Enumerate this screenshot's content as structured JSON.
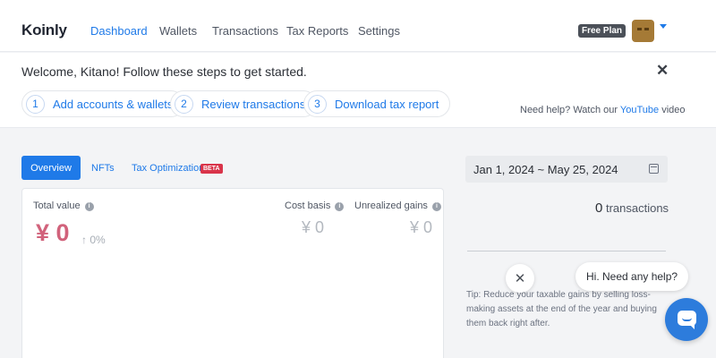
{
  "app": {
    "logo": "Koinly"
  },
  "nav": {
    "items": [
      {
        "label": "Dashboard",
        "active": true
      },
      {
        "label": "Wallets"
      },
      {
        "label": "Transactions"
      },
      {
        "label": "Tax Reports"
      },
      {
        "label": "Settings"
      }
    ],
    "plan_badge": "Free Plan",
    "accent_color": "#1f7ae8"
  },
  "welcome": {
    "message": "Welcome, Kitano! Follow these steps to get started.",
    "close_symbol": "✕",
    "steps": [
      {
        "number": "1",
        "label": "Add accounts & wallets"
      },
      {
        "number": "2",
        "label": "Review transactions"
      },
      {
        "number": "3",
        "label": "Download tax report"
      }
    ],
    "help_prefix": "Need help? Watch our",
    "help_link": "YouTube",
    "help_suffix": "video"
  },
  "tabs": {
    "overview": "Overview",
    "nfts": "NFTs",
    "tax_optimization": "Tax Optimization",
    "beta_badge": "BETA"
  },
  "stats": {
    "total_value": {
      "label": "Total value",
      "value": "¥ 0",
      "change": "↑ 0%"
    },
    "cost_basis": {
      "label": "Cost basis",
      "value": "¥ 0"
    },
    "unrealized_gains": {
      "label": "Unrealized gains",
      "value": "¥ 0"
    },
    "info_symbol": "i"
  },
  "right_panel": {
    "date_range": "Jan 1, 2024 ~ May 25, 2024",
    "transactions_count": "0",
    "transactions_label": "transactions",
    "tip": "Tip: Reduce your taxable gains by selling loss-making assets at the end of the year and buying them back right after."
  },
  "chat": {
    "close_symbol": "✕",
    "greeting": "Hi. Need any help?"
  }
}
